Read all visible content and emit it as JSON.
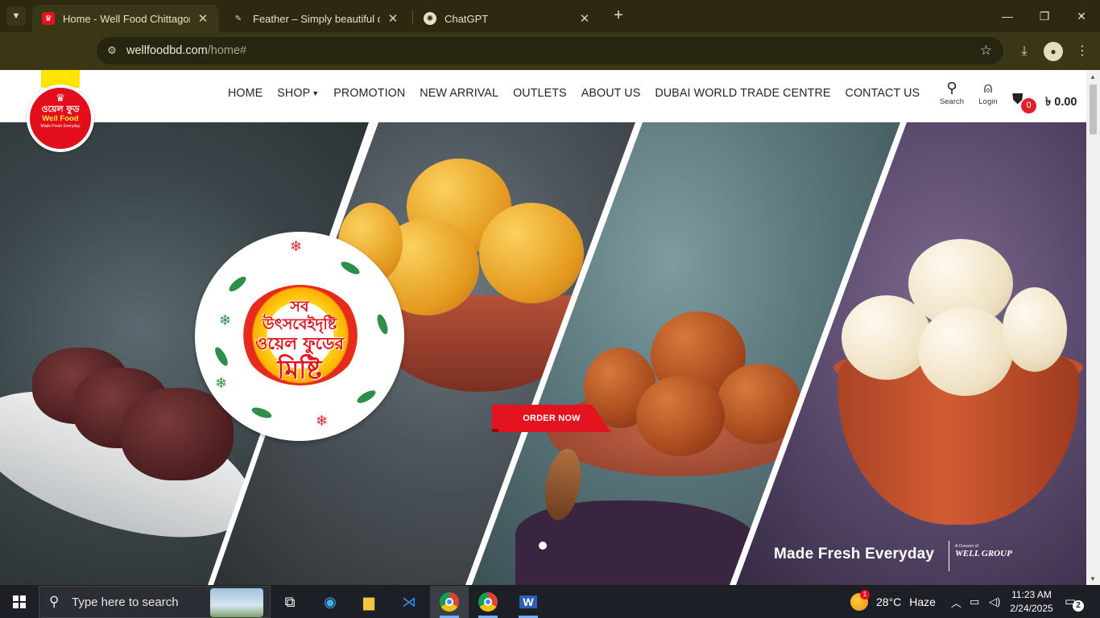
{
  "browser": {
    "tabs": [
      {
        "title": "Home - Well Food Chittagong",
        "active": true
      },
      {
        "title": "Feather – Simply beautiful open",
        "active": false
      },
      {
        "title": "ChatGPT",
        "active": false
      }
    ],
    "url_host": "wellfoodbd.com",
    "url_path": "/home#"
  },
  "site": {
    "logo": {
      "bn": "ওয়েল ফুড",
      "en": "Well Food",
      "tagline": "Made Fresh Everyday"
    },
    "nav": [
      {
        "label": "HOME"
      },
      {
        "label": "SHOP"
      },
      {
        "label": "PROMOTION"
      },
      {
        "label": "NEW ARRIVAL"
      },
      {
        "label": "OUTLETS"
      },
      {
        "label": "ABOUT US"
      },
      {
        "label": "DUBAI WORLD TRADE CENTRE"
      },
      {
        "label": "CONTACT US"
      }
    ],
    "search_label": "Search",
    "login_label": "Login",
    "cart_count": "0",
    "cart_total": "৳ 0.00",
    "hero": {
      "badge_line1": "সব",
      "badge_line2": "উৎসবেইদৃষ্টি",
      "badge_line3": "ওয়েল ফুডের",
      "badge_line4": "মিষ্টি",
      "order_button": "ORDER NOW",
      "slogan": "Made Fresh Everyday",
      "group_small": "A Concern of",
      "group_name": "WELL GROUP"
    }
  },
  "taskbar": {
    "search_placeholder": "Type here to search",
    "weather_temp": "28°C",
    "weather_cond": "Haze",
    "weather_alert": "1",
    "time": "11:23 AM",
    "date": "2/24/2025",
    "notification_count": "2"
  },
  "colors": {
    "brand_red": "#e3141f",
    "brand_yellow": "#ffe500",
    "chrome_bg": "#3a3618"
  }
}
